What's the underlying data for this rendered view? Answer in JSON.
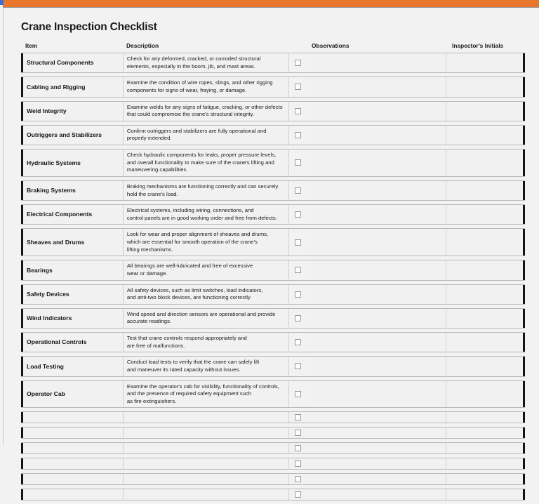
{
  "window": {
    "accent_color": "#e8762c",
    "background_color": "#f2f2f2",
    "corner_marker_color": "#3a6fd8"
  },
  "document": {
    "title": "Crane Inspection Checklist"
  },
  "table": {
    "columns": [
      {
        "key": "item",
        "label": "Item"
      },
      {
        "key": "description",
        "label": "Description"
      },
      {
        "key": "check",
        "label": ""
      },
      {
        "key": "observations",
        "label": "Observations"
      },
      {
        "key": "initials",
        "label": "Inspector's Initials"
      }
    ],
    "rows": [
      {
        "item": "Structural Components",
        "description": "Check for any deformed, cracked, or corroded structural\nelements, especially in the boom, jib, and mast areas.",
        "checked": false,
        "observations": "",
        "initials": ""
      },
      {
        "item": "Cabling and Rigging",
        "description": "Examine the condition of wire ropes, slings, and other rigging\ncomponents for signs of wear, fraying, or damage.",
        "checked": false,
        "observations": "",
        "initials": ""
      },
      {
        "item": "Weld Integrity",
        "description": "Examine welds for any signs of fatigue, cracking, or other defects\nthat could compromise the crane's structural integrity.",
        "checked": false,
        "observations": "",
        "initials": ""
      },
      {
        "item": "Outriggers and Stabilizers",
        "description": "Confirm outriggers and stabilizers are fully operational and\nproperly extended.",
        "checked": false,
        "observations": "",
        "initials": ""
      },
      {
        "item": "Hydraulic Systems",
        "description": "Check hydraulic components for leaks, proper pressure levels,\nand overall functionality to make sure of the crane's lifting and\nmaneuvering capabilities.",
        "checked": false,
        "observations": "",
        "initials": ""
      },
      {
        "item": "Braking Systems",
        "description": "Braking mechanisms are functioning correctly and can securely\nhold the crane's load.",
        "checked": false,
        "observations": "",
        "initials": ""
      },
      {
        "item": "Electrical Components",
        "description": "Electrical systems, including wiring, connections, and\ncontrol panels are in good working order and free from defects.",
        "checked": false,
        "observations": "",
        "initials": ""
      },
      {
        "item": "Sheaves and Drums",
        "description": "Look for wear and proper alignment of sheaves and drums,\nwhich are essential for smooth operation of the crane's\nlifting mechanisms.",
        "checked": false,
        "observations": "",
        "initials": ""
      },
      {
        "item": "Bearings",
        "description": "All bearings are well-lubricated and free of excessive\nwear or damage.",
        "checked": false,
        "observations": "",
        "initials": ""
      },
      {
        "item": "Safety Devices",
        "description": "All safety devices, such as limit switches, load indicators,\nand anti-two block devices, are functioning correctly",
        "checked": false,
        "observations": "",
        "initials": ""
      },
      {
        "item": "Wind Indicators",
        "description": "Wind speed and direction sensors are operational and provide\naccurate readings.",
        "checked": false,
        "observations": "",
        "initials": ""
      },
      {
        "item": "Operational Controls",
        "description": "Test that crane controls respond appropriately and\nare free of malfunctions.",
        "checked": false,
        "observations": "",
        "initials": ""
      },
      {
        "item": "Load Testing",
        "description": "Conduct load tests to verify that the crane can safely lift\nand maneuver its rated capacity without issues.",
        "checked": false,
        "observations": "",
        "initials": ""
      },
      {
        "item": "Operator Cab",
        "description": "Examine the operator's cab for visibility, functionality of controls,\nand the presence of required safety equipment such\nas fire extinguishers.",
        "checked": false,
        "observations": "",
        "initials": ""
      },
      {
        "item": "",
        "description": "",
        "checked": false,
        "observations": "",
        "initials": ""
      },
      {
        "item": "",
        "description": "",
        "checked": false,
        "observations": "",
        "initials": ""
      },
      {
        "item": "",
        "description": "",
        "checked": false,
        "observations": "",
        "initials": ""
      },
      {
        "item": "",
        "description": "",
        "checked": false,
        "observations": "",
        "initials": ""
      },
      {
        "item": "",
        "description": "",
        "checked": false,
        "observations": "",
        "initials": ""
      },
      {
        "item": "",
        "description": "",
        "checked": false,
        "observations": "",
        "initials": ""
      }
    ]
  }
}
